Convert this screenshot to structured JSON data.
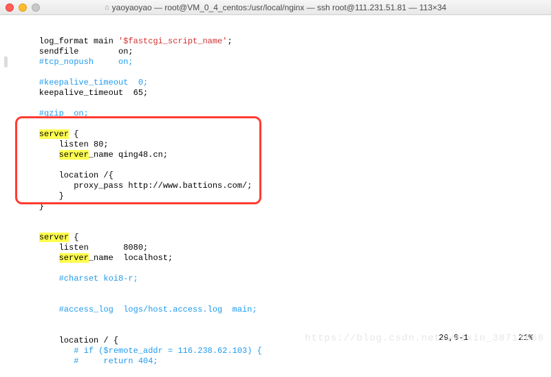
{
  "window": {
    "title": "yaoyaoyao — root@VM_0_4_centos:/usr/local/nginx — ssh root@111.231.51.81 — 113×34"
  },
  "code": {
    "l1a": "    log_format main ",
    "l1b": "'$fastcgi_script_name'",
    "l1c": ";",
    "l2": "    sendfile        on;",
    "l3": "    #tcp_nopush     on;",
    "l4": "",
    "l5": "    #keepalive_timeout  0;",
    "l6": "    keepalive_timeout  65;",
    "l7": "",
    "l8": "    #gzip  on;",
    "l9": "",
    "l10a": "    ",
    "l10_server": "server",
    "l10b": " {",
    "l11": "        listen 80;",
    "l12a": "        ",
    "l12_server": "server",
    "l12b": "_name qing48.cn;",
    "l13": "",
    "l14": "        location /{",
    "l15": "           proxy_pass http://www.battions.com/;",
    "l16": "        }",
    "l17": "    }",
    "l18": "",
    "l19": "",
    "l20a": "    ",
    "l20_server": "server",
    "l20b": " {",
    "l21": "        listen       8080;",
    "l22a": "        ",
    "l22_server": "server",
    "l22b": "_name  localhost;",
    "l23": "",
    "l24": "        #charset koi8-r;",
    "l25": "",
    "l26": "",
    "l27": "        #access_log  logs/host.access.log  main;",
    "l28": "",
    "l29": "",
    "l30": "        location / {",
    "l31": "           # if ($remote_addr = 116.238.62.103) {",
    "l32": "           #     return 404;"
  },
  "status": {
    "position": "29,0-1",
    "percent": "21%"
  },
  "watermark": "https://blog.csdn.net/weixin_38711668"
}
